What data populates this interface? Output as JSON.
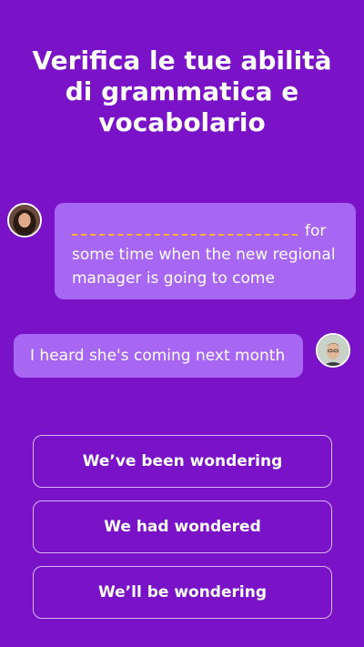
{
  "header": {
    "title": "Verifica le tue abilità di grammatica e vocabolario"
  },
  "chat": {
    "question_after_blank": "for",
    "question_rest": "some time when the new regional manager is going to come",
    "reply": "I heard she's coming next month"
  },
  "options": [
    {
      "label": "We’ve been wondering"
    },
    {
      "label": "We had wondered"
    },
    {
      "label": "We’ll be wondering"
    }
  ],
  "colors": {
    "background": "#7a13c8",
    "bubble": "#a767f3",
    "blank_dash": "#f4b728",
    "option_border": "#d8b8f6"
  }
}
